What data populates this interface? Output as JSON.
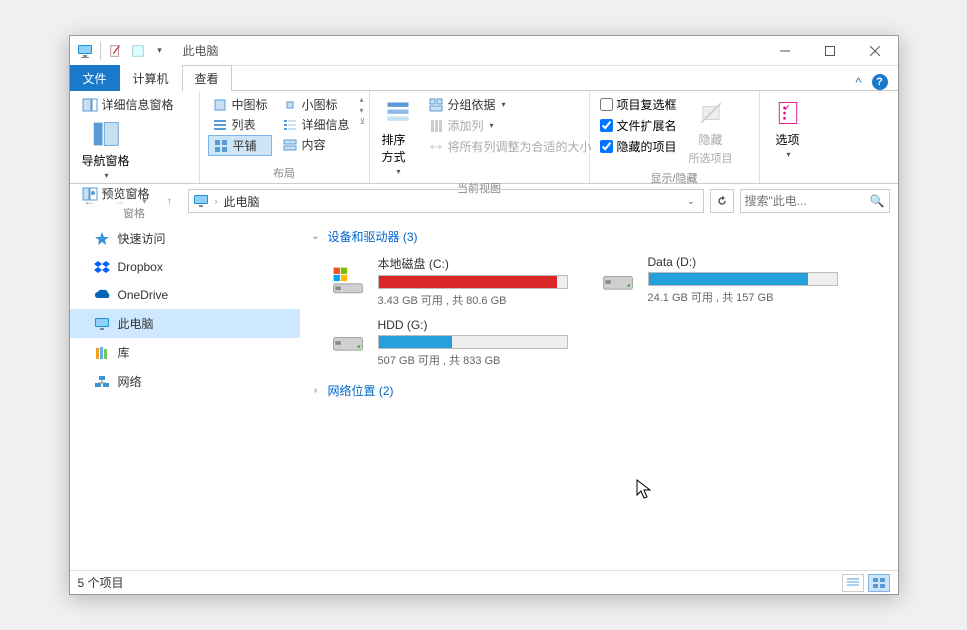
{
  "window_title": "此电脑",
  "tabs": {
    "file": "文件",
    "computer": "计算机",
    "view": "查看"
  },
  "ribbon": {
    "panes": {
      "nav_pane": "导航窗格",
      "preview_pane": "预览窗格",
      "details_pane": "详细信息窗格",
      "group_label": "窗格"
    },
    "layout": {
      "medium_icons": "中图标",
      "small_icons": "小图标",
      "list": "列表",
      "details": "详细信息",
      "tiles": "平铺",
      "content": "内容",
      "group_label": "布局"
    },
    "current_view": {
      "sort_by": "排序方式",
      "group_by": "分组依据",
      "add_columns": "添加列",
      "size_all_columns": "将所有列调整为合适的大小",
      "group_label": "当前视图"
    },
    "show_hide": {
      "item_checkboxes": "项目复选框",
      "file_extensions": "文件扩展名",
      "hidden_items": "隐藏的项目",
      "hide_selected": "隐藏",
      "hide_selected_sub": "所选项目",
      "group_label": "显示/隐藏"
    },
    "options": "选项"
  },
  "ribbon_checks": {
    "item_checkboxes": false,
    "file_extensions": true,
    "hidden_items": true
  },
  "breadcrumb": {
    "root": "此电脑"
  },
  "search_placeholder": "搜索\"此电...",
  "sidebar": {
    "quick_access": "快速访问",
    "dropbox": "Dropbox",
    "onedrive": "OneDrive",
    "this_pc": "此电脑",
    "libraries": "库",
    "network": "网络"
  },
  "sections": {
    "devices": {
      "label": "设备和驱动器",
      "count": 3
    },
    "network": {
      "label": "网络位置",
      "count": 2
    }
  },
  "drives": [
    {
      "name": "本地磁盘 (C:)",
      "free": "3.43 GB",
      "total": "80.6 GB",
      "fill_percent": 95,
      "color": "red",
      "system": true
    },
    {
      "name": "Data (D:)",
      "free": "24.1 GB",
      "total": "157 GB",
      "fill_percent": 85,
      "color": "blue",
      "system": false
    },
    {
      "name": "HDD (G:)",
      "free": "507 GB",
      "total": "833 GB",
      "fill_percent": 39,
      "color": "blue",
      "system": false
    }
  ],
  "drive_stats_template": {
    "free_label": "可用 , 共"
  },
  "status": {
    "item_count_label": "5 个项目"
  }
}
